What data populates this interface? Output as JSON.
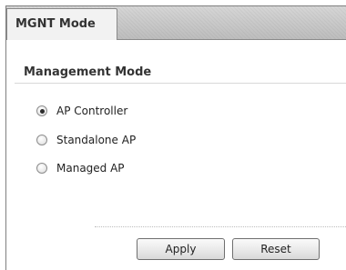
{
  "tabs": [
    {
      "label": "MGNT Mode",
      "active": true
    }
  ],
  "section": {
    "title": "Management Mode"
  },
  "options": [
    {
      "label": "AP Controller",
      "selected": true
    },
    {
      "label": "Standalone AP",
      "selected": false
    },
    {
      "label": "Managed AP",
      "selected": false
    }
  ],
  "buttons": {
    "apply_label": "Apply",
    "reset_label": "Reset"
  },
  "colors": {
    "tab_strip": "#c8c8c8",
    "text": "#333333"
  }
}
